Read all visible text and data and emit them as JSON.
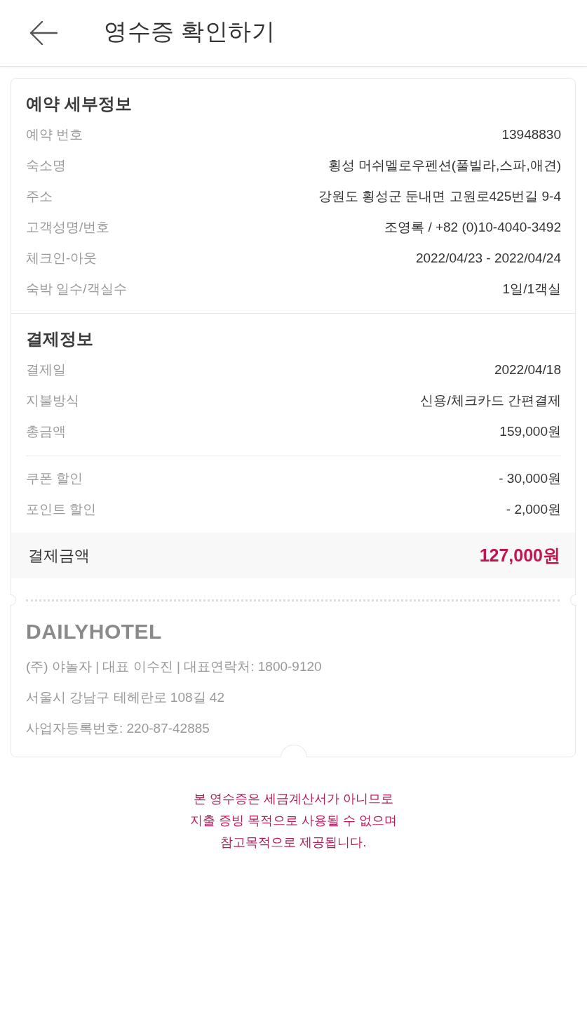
{
  "header": {
    "title": "영수증 확인하기"
  },
  "booking": {
    "title": "예약 세부정보",
    "rows": [
      {
        "label": "예약 번호",
        "value": "13948830"
      },
      {
        "label": "숙소명",
        "value": "횡성 머쉬멜로우펜션(풀빌라,스파,애견)"
      },
      {
        "label": "주소",
        "value": "강원도 횡성군 둔내면 고원로425번길 9-4"
      },
      {
        "label": "고객성명/번호",
        "value": "조영록 / +82 (0)10-4040-3492"
      },
      {
        "label": "체크인-아웃",
        "value": "2022/04/23 - 2022/04/24"
      },
      {
        "label": "숙박 일수/객실수",
        "value": "1일/1객실"
      }
    ]
  },
  "payment": {
    "title": "결제정보",
    "rows": [
      {
        "label": "결제일",
        "value": "2022/04/18"
      },
      {
        "label": "지불방식",
        "value": "신용/체크카드 간편결제"
      },
      {
        "label": "총금액",
        "value": "159,000원"
      }
    ],
    "discounts": [
      {
        "label": "쿠폰 할인",
        "value": "- 30,000원"
      },
      {
        "label": "포인트 할인",
        "value": "- 2,000원"
      }
    ],
    "total": {
      "label": "결제금액",
      "value": "127,000원"
    }
  },
  "company": {
    "logo": "DAILYHOTEL",
    "lines": [
      "(주) 야놀자 | 대표 이수진 | 대표연락처: 1800-9120",
      "서울시 강남구 테헤란로 108길 42",
      "사업자등록번호: 220-87-42885"
    ]
  },
  "notice": "본 영수증은 세금계산서가 아니므로\n지출 증빙 목적으로 사용될 수 없으며\n참고목적으로 제공됩니다."
}
